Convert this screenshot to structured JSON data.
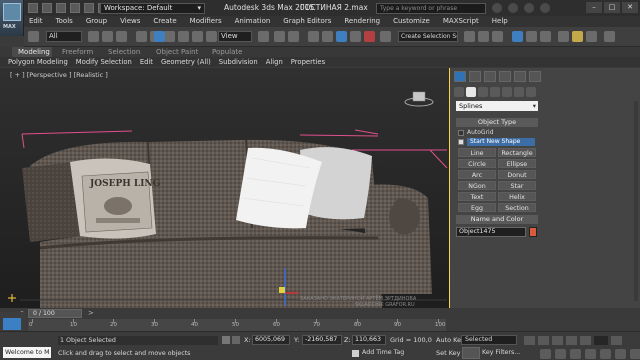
{
  "app": {
    "title": "Autodesk 3ds Max  2015",
    "file": "ГОСТИНАЯ 2.max",
    "workspace": "Workspace: Default",
    "search_placeholder": "Type a keyword or phrase",
    "logo_text": "MAX"
  },
  "menu": [
    "Edit",
    "Tools",
    "Group",
    "Views",
    "Create",
    "Modifiers",
    "Animation",
    "Graph Editors",
    "Rendering",
    "Customize",
    "MAXScript",
    "Help"
  ],
  "toolbar": {
    "selection_filter": "All",
    "reference_coord": "View",
    "named_selection": "Create Selection Se"
  },
  "ribbon": {
    "tabs": [
      "Modeling",
      "Freeform",
      "Selection",
      "Object Paint",
      "Populate"
    ],
    "active_tab": "Modeling",
    "panel_items": [
      "Polygon Modeling",
      "Modify Selection",
      "Edit",
      "Geometry (All)",
      "Subdivision",
      "Align",
      "Properties"
    ]
  },
  "viewport": {
    "label": "[ + ] [Perspective ] [Realistic ]",
    "pillow_text_top": "JOSEPH LING",
    "watermark": "ЗАКАЗАНО ЭКАТЕРИНОЙ АРТЁМ ЭРТДИНОВА",
    "watermark2": "SKLADCHIK GRAFOR.RU"
  },
  "command_panel": {
    "category": "Splines",
    "object_type_header": "Object Type",
    "autogrid_label": "AutoGrid",
    "start_new_shape_label": "Start New Shape",
    "buttons": [
      "Line",
      "Rectangle",
      "Circle",
      "Ellipse",
      "Arc",
      "Donut",
      "NGon",
      "Star",
      "Text",
      "Helix",
      "Egg",
      "Section"
    ],
    "name_color_header": "Name and Color",
    "object_name": "Object1475",
    "object_color": "#d85b3d"
  },
  "timeline": {
    "frame_display": "0 / 100",
    "ticks": [
      "0",
      "10",
      "20",
      "30",
      "40",
      "50",
      "60",
      "70",
      "80",
      "90",
      "100"
    ]
  },
  "status": {
    "maxscript_text": "Welcome to M",
    "selection_count": "1 Object Selected",
    "prompt": "Click and drag to select and move objects",
    "x_label": "X:",
    "x_value": "6005,069",
    "y_label": "Y:",
    "y_value": "-2160,587",
    "z_label": "Z:",
    "z_value": "110,663",
    "grid": "Grid = 100,0",
    "add_time_tag": "Add Time Tag",
    "auto_key": "Auto Key",
    "set_key": "Set Key",
    "key_mode": "Selected",
    "key_filters": "Key Filters..."
  },
  "colors": {
    "accent_blue": "#3f7fbf",
    "viewport_border": "#ffd23f",
    "bounding_box": "#e0508a"
  }
}
